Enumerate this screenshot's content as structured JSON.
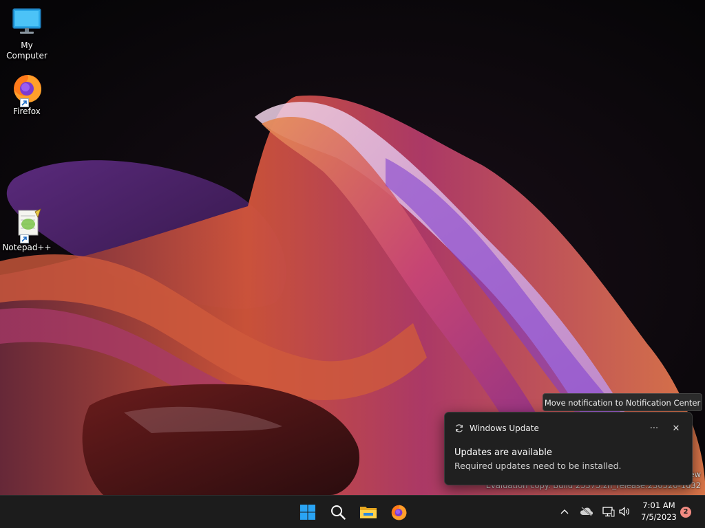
{
  "desktop": {
    "icons": [
      {
        "label": "My Computer",
        "icon": "monitor-icon"
      },
      {
        "label": "Firefox",
        "icon": "firefox-icon"
      },
      {
        "label": "Notepad++",
        "icon": "notepad-plus-plus-icon"
      }
    ]
  },
  "watermark": {
    "line1": "ew",
    "line2": "Evaluation copy. Build 25375.zn_release.230520-1632"
  },
  "tooltip": {
    "text": "Move notification to Notification Center"
  },
  "toast": {
    "app_name": "Windows Update",
    "app_icon": "sync-icon",
    "more_label": "···",
    "close_label": "✕",
    "title": "Updates are available",
    "body": "Required updates need to be installed."
  },
  "taskbar": {
    "apps": [
      {
        "name": "Start",
        "icon": "windows-logo-icon"
      },
      {
        "name": "Search",
        "icon": "search-icon"
      },
      {
        "name": "File Explorer",
        "icon": "folder-icon"
      },
      {
        "name": "Firefox",
        "icon": "firefox-icon"
      }
    ],
    "tray": {
      "chevron": "^",
      "time": "7:01 AM",
      "date": "7/5/2023",
      "notification_count": "2"
    }
  },
  "colors": {
    "taskbar_bg": "#1c1c1c",
    "toast_bg": "#202020",
    "windows_blue": "#2aa4f4",
    "badge": "#f28b82"
  }
}
